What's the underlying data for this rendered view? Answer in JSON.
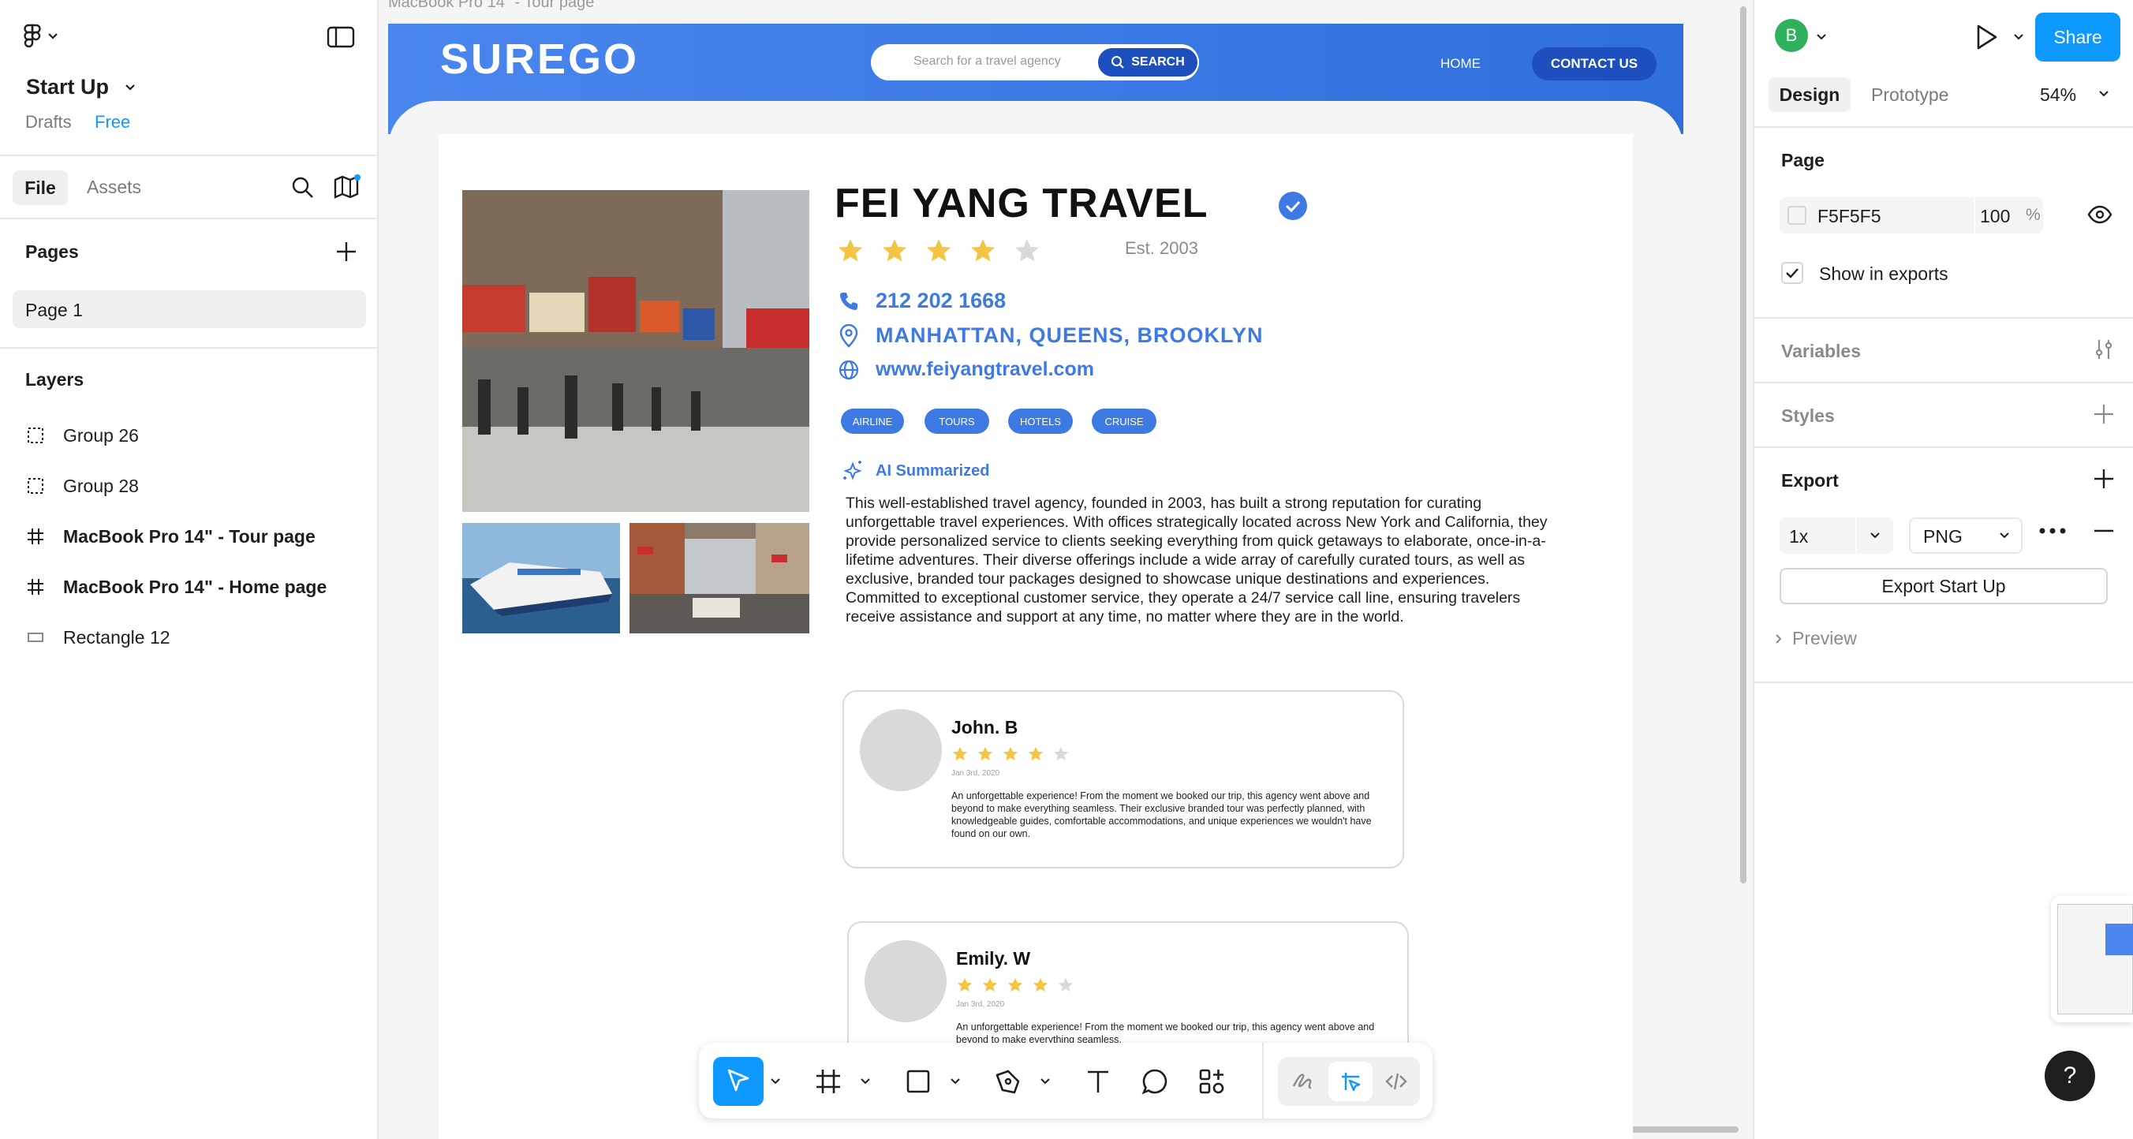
{
  "canvas": {
    "frame_label": "MacBook Pro 14\" - Tour page"
  },
  "left_panel": {
    "project": "Start Up",
    "drafts": "Drafts",
    "plan": "Free",
    "tabs": [
      "File",
      "Assets"
    ],
    "pages_title": "Pages",
    "pages": [
      "Page 1"
    ],
    "layers_title": "Layers",
    "layers": [
      {
        "name": "Group 26",
        "icon": "group-icon",
        "bold": false
      },
      {
        "name": "Group 28",
        "icon": "group-icon",
        "bold": false
      },
      {
        "name": "MacBook Pro 14\" - Tour page",
        "icon": "frame-icon",
        "bold": true
      },
      {
        "name": "MacBook Pro 14\" - Home page",
        "icon": "frame-icon",
        "bold": true
      },
      {
        "name": "Rectangle 12",
        "icon": "rectangle-icon",
        "bold": false
      }
    ]
  },
  "right_panel": {
    "avatar_letter": "B",
    "share": "Share",
    "tabs": [
      "Design",
      "Prototype"
    ],
    "zoom": "54%",
    "page_title": "Page",
    "page_color": "F5F5F5",
    "page_opacity": "100",
    "percent": "%",
    "show_in_exports": "Show in exports",
    "variables": "Variables",
    "styles": "Styles",
    "export_title": "Export",
    "export_scale": "1x",
    "export_format": "PNG",
    "export_button": "Export Start Up",
    "preview": "Preview",
    "help": "?"
  },
  "site": {
    "logo": "SUREGO",
    "search_placeholder": "Search for a travel agency",
    "search_button": "SEARCH",
    "nav_home": "HOME",
    "nav_contact": "CONTACT US",
    "agency_name": "FEI YANG TRAVEL",
    "rating": 4,
    "rating_max": 5,
    "established": "Est. 2003",
    "phone": "212 202 1668",
    "locations": "MANHATTAN, QUEENS, BROOKLYN",
    "website": "www.feiyangtravel.com",
    "tags": [
      "AIRLINE",
      "TOURS",
      "HOTELS",
      "CRUISE"
    ],
    "ai_label": "AI Summarized",
    "summary": "This well-established travel agency, founded in 2003, has built a strong reputation for curating unforgettable travel experiences. With offices strategically located across New York and California, they provide personalized service to clients seeking everything from quick getaways to elaborate, once-in-a-lifetime adventures. Their diverse offerings include a wide array of carefully curated tours, as well as exclusive, branded tour packages designed to showcase unique destinations and experiences. Committed to exceptional customer service, they operate a 24/7 service call line, ensuring travelers receive assistance and support at any time, no matter where they are in the world.",
    "reviews": [
      {
        "name": "John. B",
        "rating": 4,
        "date": "Jan 3rd, 2020",
        "text": "An unforgettable experience! From the moment we booked our trip, this agency went above and beyond to make everything seamless. Their exclusive branded tour was perfectly planned, with knowledgeable guides, comfortable accommodations, and unique experiences we wouldn't have found on our own."
      },
      {
        "name": "Emily. W",
        "rating": 4,
        "date": "Jan 3rd, 2020",
        "text": "An unforgettable experience! From the moment we booked our trip, this agency went above and beyond to make everything seamless."
      }
    ]
  },
  "colors": {
    "accent": "#0d99ff",
    "site_blue": "#3d7ae3",
    "star": "#f4c542",
    "star_empty": "#d9d9d9"
  }
}
